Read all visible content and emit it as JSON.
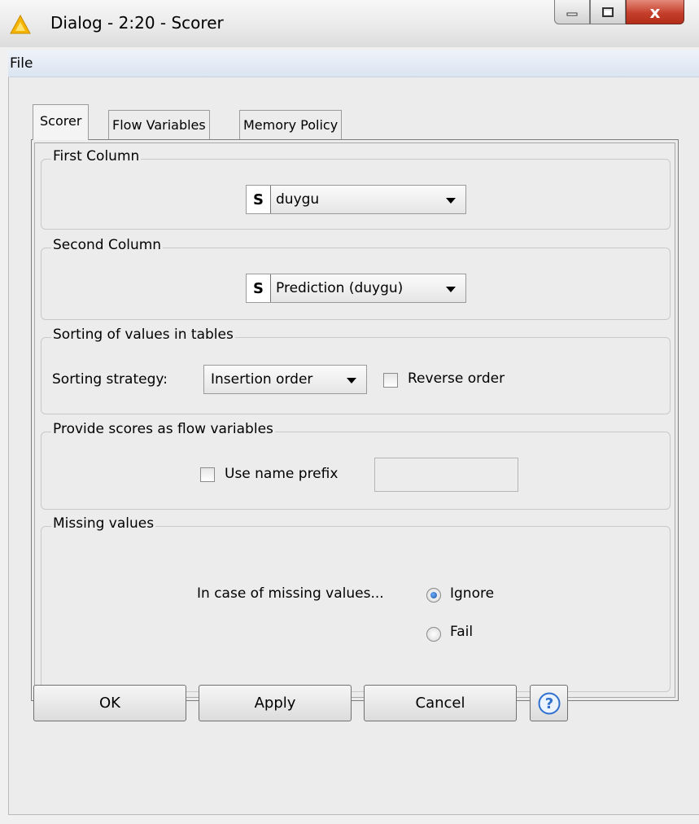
{
  "window": {
    "title": "Dialog - 2:20 - Scorer",
    "icon": "knime-warning-triangle-icon",
    "controls": {
      "minimize": "minimize-icon",
      "maximize": "maximize-icon",
      "close": "x"
    }
  },
  "menubar": {
    "file": "File"
  },
  "tabs": [
    {
      "label": "Scorer",
      "active": true
    },
    {
      "label": "Flow Variables",
      "active": false
    },
    {
      "label": "Memory Policy",
      "active": false
    }
  ],
  "groups": {
    "first_column": {
      "title": "First Column",
      "type_badge": "S",
      "selected": "duygu"
    },
    "second_column": {
      "title": "Second Column",
      "type_badge": "S",
      "selected": "Prediction (duygu)"
    },
    "sorting": {
      "title": "Sorting of values in tables",
      "strategy_label": "Sorting strategy:",
      "strategy_value": "Insertion order",
      "reverse_label": "Reverse order",
      "reverse_checked": false
    },
    "flow_vars": {
      "title": "Provide scores as flow variables",
      "prefix_label": "Use name prefix",
      "prefix_checked": false,
      "prefix_value": ""
    },
    "missing": {
      "title": "Missing values",
      "prompt": "In case of missing values...",
      "options": [
        {
          "label": "Ignore",
          "checked": true
        },
        {
          "label": "Fail",
          "checked": false
        }
      ]
    }
  },
  "buttons": {
    "ok": "OK",
    "apply": "Apply",
    "cancel": "Cancel",
    "help_icon": "help-icon"
  },
  "colors": {
    "close_button": "#c5402c",
    "menubar": "#dbe4f1",
    "radio_selected": "#1b4f9a"
  }
}
